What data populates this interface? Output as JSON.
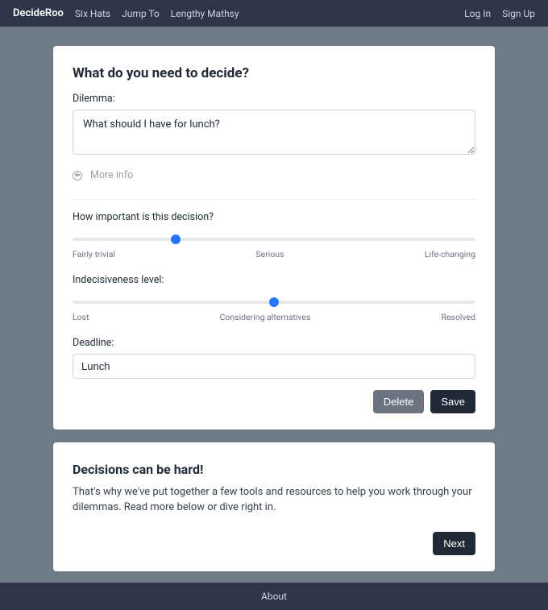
{
  "nav": {
    "brand": "DecideRoo",
    "links": [
      "Six Hats",
      "Jump To",
      "Lengthy Mathsy"
    ],
    "right": [
      "Log In",
      "Sign Up"
    ]
  },
  "form": {
    "heading": "What do you need to decide?",
    "dilemma_label": "Dilemma:",
    "dilemma_value": "What should I have for lunch?",
    "more_info": "More info",
    "importance": {
      "question": "How important is this decision?",
      "value": 25,
      "labels": [
        "Fairly trivial",
        "Serious",
        "Life-changing"
      ]
    },
    "indecisiveness": {
      "question": "Indecisiveness level:",
      "value": 50,
      "labels": [
        "Lost",
        "Considering alternatives",
        "Resolved"
      ]
    },
    "deadline_label": "Deadline:",
    "deadline_value": "Lunch",
    "buttons": {
      "delete": "Delete",
      "save": "Save"
    }
  },
  "info": {
    "heading": "Decisions can be hard!",
    "body": "That's why we've put together a few tools and resources to help you work through your dilemmas. Read more below or dive right in.",
    "next": "Next"
  },
  "footer": {
    "about": "About"
  }
}
